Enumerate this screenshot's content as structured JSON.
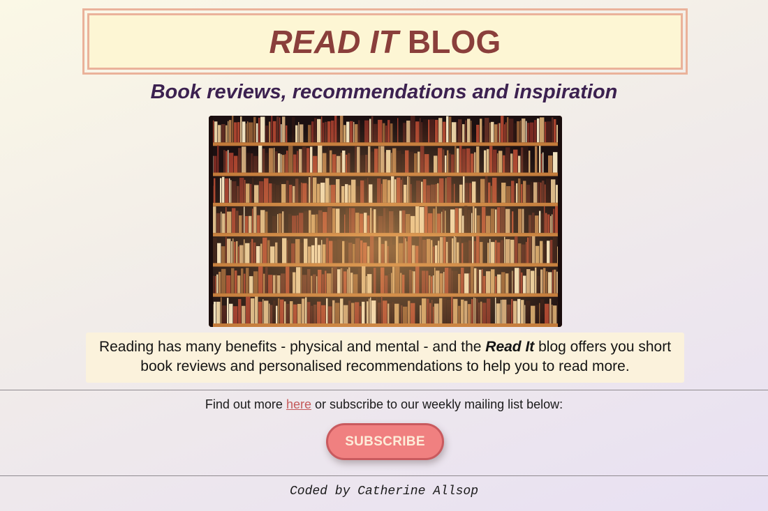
{
  "header": {
    "title_part1": "READ IT",
    "title_part2": "BLOG",
    "subtitle": "Book reviews, recommendations and inspiration"
  },
  "hero": {
    "alt": "Library bookshelves full of books"
  },
  "intro": {
    "text_before": "Reading has many benefits - physical and mental - and the ",
    "emphasis": "Read It",
    "text_after": " blog offers you short book reviews and personalised recommendations to help you to read more."
  },
  "cta": {
    "text_before": "Find out more ",
    "link_label": "here",
    "text_after": " or subscribe to our weekly mailing list below:",
    "button_label": "SUBSCRIBE"
  },
  "footer": {
    "credit": "Coded by Catherine Allsop"
  },
  "colors": {
    "title": "#8a3f3b",
    "title_border": "#eab29a",
    "subtitle": "#3c2150",
    "button": "#f08080",
    "link": "#c45a5a"
  }
}
